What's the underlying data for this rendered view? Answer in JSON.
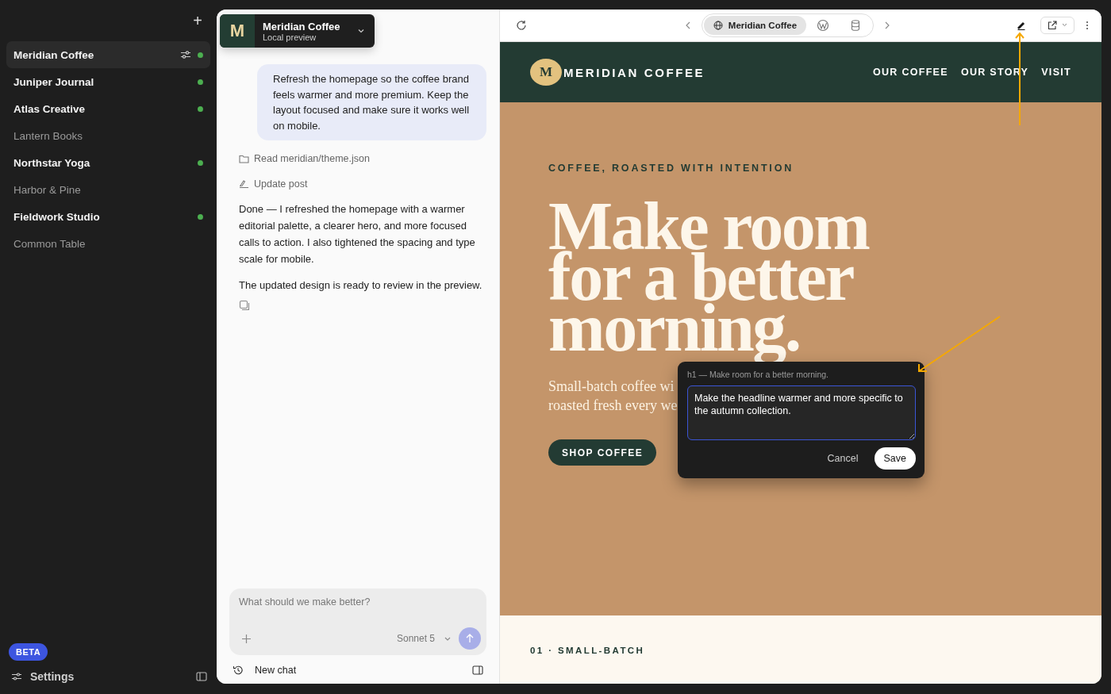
{
  "sidebar": {
    "add_label": "+",
    "projects": [
      {
        "name": "Meridian Coffee",
        "selected": true,
        "online": true
      },
      {
        "name": "Juniper Journal",
        "selected": false,
        "online": true
      },
      {
        "name": "Atlas Creative",
        "selected": false,
        "online": true
      },
      {
        "name": "Lantern Books",
        "selected": false,
        "online": false
      },
      {
        "name": "Northstar Yoga",
        "selected": false,
        "online": true
      },
      {
        "name": "Harbor & Pine",
        "selected": false,
        "online": false
      },
      {
        "name": "Fieldwork Studio",
        "selected": false,
        "online": true
      },
      {
        "name": "Common Table",
        "selected": false,
        "online": false
      }
    ],
    "badge": "BETA",
    "settings": "Settings"
  },
  "chat": {
    "site": {
      "logo": "M",
      "name": "Meridian Coffee",
      "subtitle": "Local preview"
    },
    "user_message": "Refresh the homepage so the coffee brand feels warmer and more premium. Keep the layout focused and make sure it works well on mobile.",
    "steps": [
      {
        "kind": "folder",
        "label": "Read meridian/theme.json"
      },
      {
        "kind": "edit",
        "label": "Update post"
      }
    ],
    "reply": [
      "Done — I refreshed the homepage with a warmer editorial palette, a clearer hero, and more focused calls to action. I also tightened the spacing and type scale for mobile.",
      "The updated design is ready to review in the preview."
    ],
    "composer": {
      "placeholder": "What should we make better?",
      "model": "Sonnet 5"
    },
    "footer": {
      "new_chat": "New chat"
    }
  },
  "preview": {
    "tab": "Meridian Coffee",
    "site": {
      "logo": "M",
      "brand": "MERIDIAN COFFEE",
      "nav": [
        "OUR COFFEE",
        "OUR STORY",
        "VISIT"
      ],
      "eyebrow": "COFFEE, ROASTED WITH INTENTION",
      "headline": "Make room for a better morning.",
      "subtitle_lines": [
        "Small-batch coffee wi",
        "roasted fresh every we"
      ],
      "cta": "SHOP COFFEE",
      "section": "01 · SMALL-BATCH"
    },
    "editor": {
      "target": "h1 — Make room for a better morning.",
      "value": "Make the headline warmer and more specific to the autumn collection.",
      "cancel": "Cancel",
      "save": "Save"
    }
  }
}
